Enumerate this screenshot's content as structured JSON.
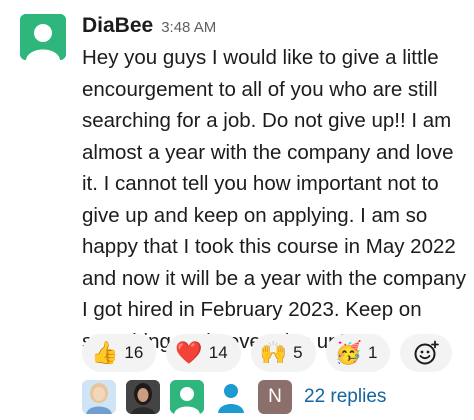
{
  "message": {
    "sender": "DiaBee",
    "time": "3:48 AM",
    "avatar_icon": "default-user-avatar-icon",
    "text": "Hey you guys I would like to give a little encourgement to all of you who are still searching for a job. Do not give up!! I am almost a year with the company and love it. I cannot tell you how important not to give up and keep on applying. I am so happy that I took this course in May 2022 and now it will be a year with the company I got hired in February 2023. Keep on searching and never give up!"
  },
  "reactions": [
    {
      "emoji": "👍",
      "icon": "thumbs-up-icon",
      "count": "16"
    },
    {
      "emoji": "❤️",
      "icon": "heart-icon",
      "count": "14"
    },
    {
      "emoji": "🙌",
      "icon": "raised-hands-icon",
      "count": "5"
    },
    {
      "emoji": "🥳",
      "icon": "party-face-icon",
      "count": "1"
    }
  ],
  "add_reaction_icon": "add-reaction-icon",
  "thread": {
    "participant_initial": "N",
    "replies_label": "22 replies"
  },
  "colors": {
    "avatar_green": "#2eb67d",
    "link_blue": "#1264a3",
    "reaction_bg": "#f3f3f3"
  }
}
